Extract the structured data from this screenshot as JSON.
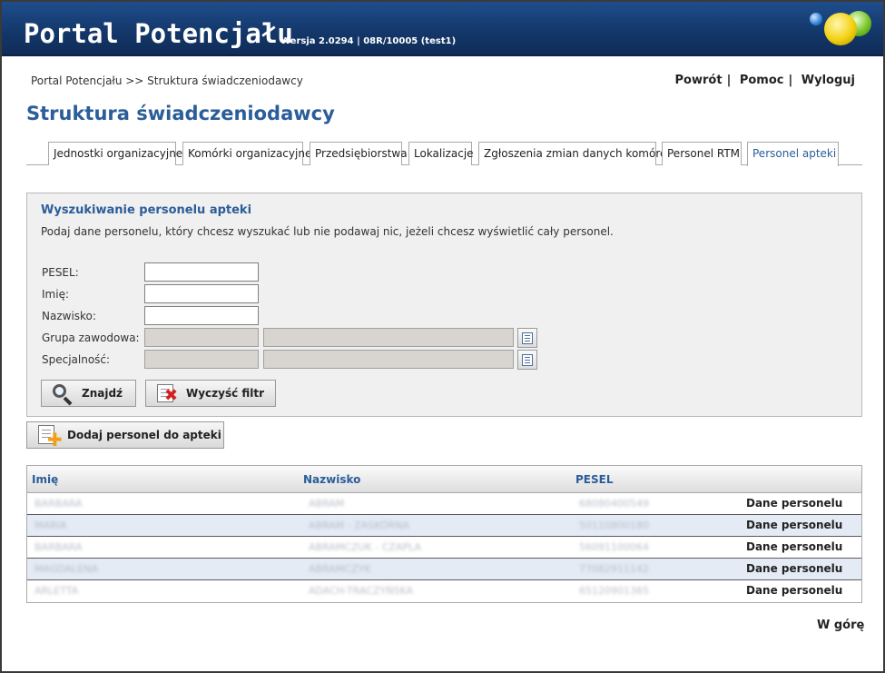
{
  "header": {
    "app_title": "Portal Potencjału",
    "version": "Wersja 2.0294 | 08R/10005 (test1)"
  },
  "breadcrumb": "Portal Potencjału >> Struktura świadczeniodawcy",
  "top_links": {
    "back": "Powrót",
    "help": "Pomoc",
    "logout": "Wyloguj",
    "separator": "|"
  },
  "page_title": "Struktura świadczeniodawcy",
  "tabs": [
    {
      "label": "Jednostki organizacyjne",
      "active": false
    },
    {
      "label": "Komórki organizacyjne",
      "active": false
    },
    {
      "label": "Przedsiębiorstwa",
      "active": false
    },
    {
      "label": "Lokalizacje",
      "active": false
    },
    {
      "label": "Zgłoszenia zmian danych komórek",
      "active": false
    },
    {
      "label": "Personel RTM",
      "active": false
    },
    {
      "label": "Personel apteki",
      "active": true
    }
  ],
  "search": {
    "title": "Wyszukiwanie personelu apteki",
    "description": "Podaj dane personelu, który chcesz wyszukać lub nie podawaj nic, jeżeli chcesz wyświetlić cały personel.",
    "fields": {
      "pesel": {
        "label": "PESEL:",
        "value": ""
      },
      "first_name": {
        "label": "Imię:",
        "value": ""
      },
      "last_name": {
        "label": "Nazwisko:",
        "value": ""
      },
      "professional_group": {
        "label": "Grupa zawodowa:",
        "code": "",
        "name": ""
      },
      "specialty": {
        "label": "Specjalność:",
        "code": "",
        "name": ""
      }
    },
    "find_button": "Znajdź",
    "clear_button": "Wyczyść filtr"
  },
  "add_button": "Dodaj personel do apteki",
  "table": {
    "columns": [
      "Imię",
      "Nazwisko",
      "PESEL",
      ""
    ],
    "rows": [
      {
        "first_name": "BARBARA",
        "last_name": "ABRAM",
        "pesel": "68080400549",
        "action": "Dane personelu"
      },
      {
        "first_name": "MARIA",
        "last_name": "ABRAM - ZASKÓRNA",
        "pesel": "50110800180",
        "action": "Dane personelu"
      },
      {
        "first_name": "BARBARA",
        "last_name": "ABRAMCZUK - CZAPLA",
        "pesel": "56091100064",
        "action": "Dane personelu"
      },
      {
        "first_name": "MAGDALENA",
        "last_name": "ABRAMCZYK",
        "pesel": "77082911142",
        "action": "Dane personelu"
      },
      {
        "first_name": "ARLETTA",
        "last_name": "ADACH-TRACZYŃSKA",
        "pesel": "65120901365",
        "action": "Dane personelu"
      }
    ]
  },
  "go_top": "W górę"
}
